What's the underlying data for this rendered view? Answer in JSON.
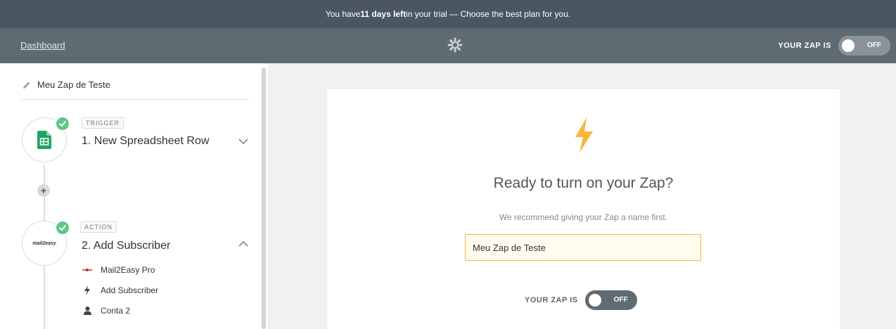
{
  "trial": {
    "prefix": "You have ",
    "days": "11 days left",
    "suffix": " in your trial — Choose the best plan for you."
  },
  "header": {
    "dashboard_label": "Dashboard",
    "zap_status_label": "YOUR ZAP IS",
    "toggle_state": "OFF"
  },
  "sidebar": {
    "zap_name": "Meu Zap de Teste",
    "steps": [
      {
        "tag": "TRIGGER",
        "title": "1. New Spreadsheet Row",
        "app_icon": "google-sheets-icon"
      },
      {
        "tag": "ACTION",
        "title": "2. Add Subscriber",
        "app_icon": "mail2easy-logo",
        "app_logo_text": "mail2easy",
        "details": [
          {
            "icon": "mail2easy-app-icon",
            "label": "Mail2Easy Pro"
          },
          {
            "icon": "bolt-icon",
            "label": "Add Subscriber"
          },
          {
            "icon": "user-icon",
            "label": "Conta 2"
          }
        ]
      }
    ]
  },
  "main": {
    "heading": "Ready to turn on your Zap?",
    "recommendation": "We recommend giving your Zap a name first.",
    "name_input_value": "Meu Zap de Teste",
    "zap_status_label": "YOUR ZAP IS",
    "toggle_state": "OFF"
  },
  "colors": {
    "trial_bar": "#4a5660",
    "header": "#5f6b73",
    "accent_bolt": "#f6b73c",
    "check": "#5bc78a",
    "sheets_green": "#1fa463"
  }
}
